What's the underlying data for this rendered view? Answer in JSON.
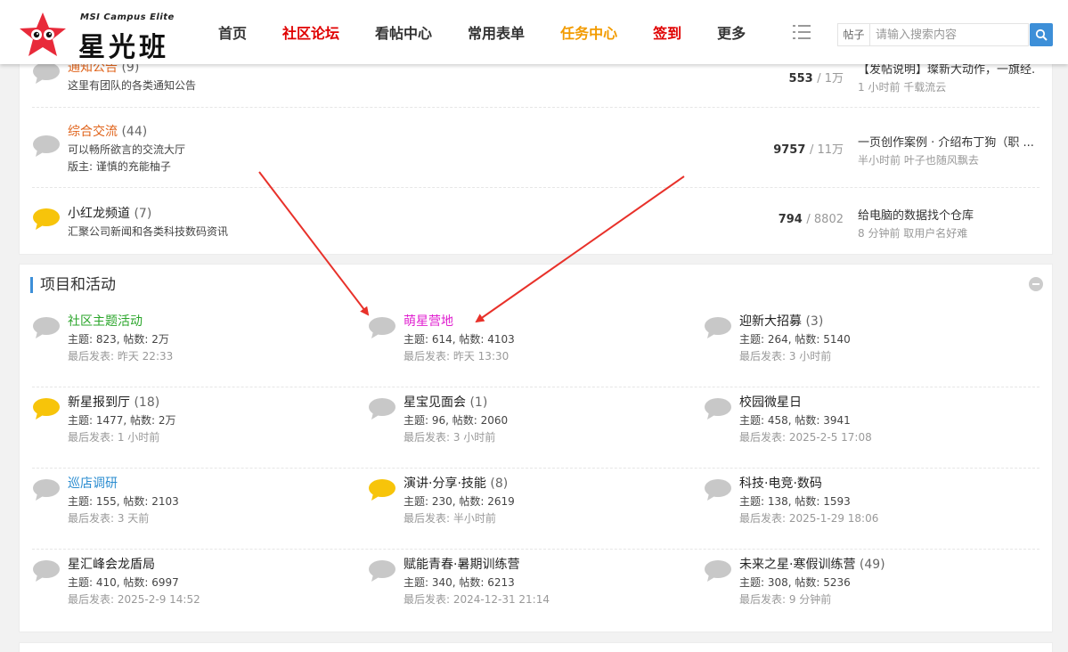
{
  "header": {
    "logo_sub": "MSI Campus Elite",
    "logo_main": "星光班",
    "nav": [
      {
        "label": "首页",
        "color": "#333333"
      },
      {
        "label": "社区论坛",
        "color": "#e00000"
      },
      {
        "label": "看帖中心",
        "color": "#333333"
      },
      {
        "label": "常用表单",
        "color": "#333333"
      },
      {
        "label": "任务中心",
        "color": "#f29b00"
      },
      {
        "label": "签到",
        "color": "#e00000"
      },
      {
        "label": "更多",
        "color": "#333333"
      }
    ],
    "search_type": "帖子",
    "search_placeholder": "请输入搜索内容"
  },
  "top_forums": [
    {
      "title": "通知公告",
      "count": "(9)",
      "title_color": "#e0631a",
      "desc": "这里有团队的各类通知公告",
      "moderator": "",
      "posts": "553",
      "total": "1万",
      "last_title": "【发帖说明】璨新大动作，一旗经...",
      "last_meta": "1 小时前 千载流云",
      "bubble": "gray"
    },
    {
      "title": "综合交流",
      "count": "(44)",
      "title_color": "#e0631a",
      "desc": "可以畅所欲言的交流大厅",
      "moderator": "版主: 谨慎的充能柚子",
      "posts": "9757",
      "total": "11万",
      "last_title": "一页创作案例 · 介绍布丁狗（职 ...",
      "last_meta": "半小时前 叶子也随风飘去",
      "bubble": "gray"
    },
    {
      "title": "小红龙频道",
      "count": "(7)",
      "title_color": "#222222",
      "desc": "汇聚公司新闻和各类科技数码资讯",
      "moderator": "",
      "posts": "794",
      "total": "8802",
      "last_title": "给电脑的数据找个仓库",
      "last_meta": "8 分钟前 取用户名好难",
      "bubble": "yellow"
    }
  ],
  "projects": {
    "section_title": "项目和活动",
    "forums": [
      {
        "title": "社区主题活动",
        "count": "",
        "title_color": "#2aa52a",
        "stats": "主题: 823, 帖数: 2万",
        "last": "最后发表: 昨天 22:33",
        "bubble": "gray"
      },
      {
        "title": "萌星营地",
        "count": "",
        "title_color": "#e020d0",
        "stats": "主题: 614, 帖数: 4103",
        "last": "最后发表: 昨天 13:30",
        "bubble": "gray"
      },
      {
        "title": "迎新大招募",
        "count": "(3)",
        "title_color": "#222222",
        "stats": "主题: 264, 帖数: 5140",
        "last": "最后发表: 3 小时前",
        "bubble": "gray"
      },
      {
        "title": "新星报到厅",
        "count": "(18)",
        "title_color": "#222222",
        "stats": "主题: 1477, 帖数: 2万",
        "last": "最后发表: 1 小时前",
        "bubble": "yellow"
      },
      {
        "title": "星宝见面会",
        "count": "(1)",
        "title_color": "#222222",
        "stats": "主题: 96, 帖数: 2060",
        "last": "最后发表: 3 小时前",
        "bubble": "gray"
      },
      {
        "title": "校园微星日",
        "count": "",
        "title_color": "#222222",
        "stats": "主题: 458, 帖数: 3941",
        "last": "最后发表: 2025-2-5 17:08",
        "bubble": "gray"
      },
      {
        "title": "巡店调研",
        "count": "",
        "title_color": "#2a8cd0",
        "stats": "主题: 155, 帖数: 2103",
        "last": "最后发表: 3 天前",
        "bubble": "gray"
      },
      {
        "title": "演讲·分享·技能",
        "count": "(8)",
        "title_color": "#222222",
        "stats": "主题: 230, 帖数: 2619",
        "last": "最后发表: 半小时前",
        "bubble": "yellow"
      },
      {
        "title": "科技·电竞·数码",
        "count": "",
        "title_color": "#222222",
        "stats": "主题: 138, 帖数: 1593",
        "last": "最后发表: 2025-1-29 18:06",
        "bubble": "gray"
      },
      {
        "title": "星汇峰会龙盾局",
        "count": "",
        "title_color": "#222222",
        "stats": "主题: 410, 帖数: 6997",
        "last": "最后发表: 2025-2-9 14:52",
        "bubble": "gray"
      },
      {
        "title": "赋能青春·暑期训练营",
        "count": "",
        "title_color": "#222222",
        "stats": "主题: 340, 帖数: 6213",
        "last": "最后发表: 2024-12-31 21:14",
        "bubble": "gray"
      },
      {
        "title": "未来之星·寒假训练营",
        "count": "(49)",
        "title_color": "#222222",
        "stats": "主题: 308, 帖数: 5236",
        "last": "最后发表: 9 分钟前",
        "bubble": "gray"
      }
    ]
  },
  "colors": {
    "accent": "#3d8fd8",
    "bubble_gray": "#c8c8c8",
    "bubble_yellow": "#f7c40a",
    "arrow": "#e8312a"
  }
}
